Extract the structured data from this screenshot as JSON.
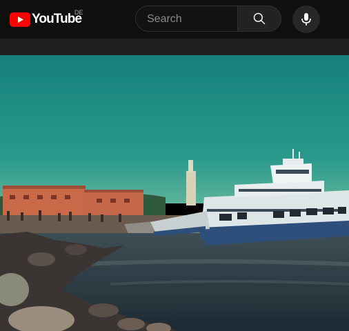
{
  "masthead": {
    "logo_text": "YouTube",
    "country_code": "DE",
    "logo_icon": "youtube-play-icon",
    "brand_color": "#ff0000"
  },
  "search": {
    "placeholder": "Search",
    "value": "",
    "button_icon": "search-icon"
  },
  "voice": {
    "icon": "microphone-icon"
  },
  "video": {
    "scene": "ferry-harbor-frame",
    "colors": {
      "sky": "#1f8a84",
      "water": "#2c3a44",
      "ferry_hull": "#2e4e7c",
      "ferry_body": "#dfe6e8",
      "building": "#c86a48"
    }
  }
}
